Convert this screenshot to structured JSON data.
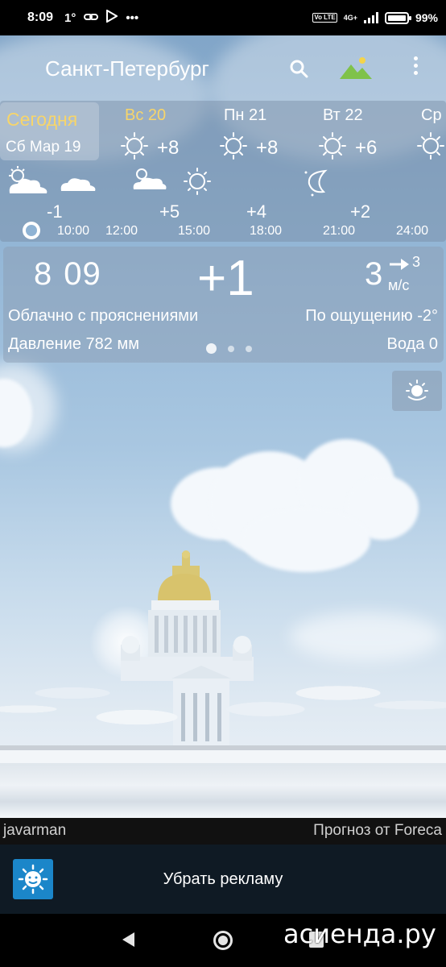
{
  "status": {
    "time": "8:09",
    "temp": "1°",
    "more": "•••",
    "volte": "Vo LTE",
    "net": "4G+",
    "battery": "99%"
  },
  "app": {
    "city": "Санкт-Петербург"
  },
  "days": {
    "today_label": "Сегодня",
    "today_date": "Сб Мар 19",
    "items": [
      {
        "name": "Вс 20",
        "temp": "+8"
      },
      {
        "name": "Пн 21",
        "temp": "+8"
      },
      {
        "name": "Вт 22",
        "temp": "+6"
      },
      {
        "name": "Ср",
        "temp": ""
      }
    ]
  },
  "hours": {
    "temps": [
      "-1",
      "+5",
      "+4",
      "+2"
    ],
    "times": [
      "10:00",
      "12:00",
      "15:00",
      "18:00",
      "21:00",
      "24:00"
    ]
  },
  "current": {
    "clock_h": "8",
    "clock_m": "09",
    "temp": "+1",
    "wind_speed": "3",
    "wind_gust": "3",
    "wind_unit": "м/с",
    "condition": "Облачно с прояснениями",
    "feels_like": "По ощущению -2°",
    "pressure": "Давление 782 мм",
    "water": "Вода 0"
  },
  "credits": {
    "author": "javarman",
    "provider": "Прогноз от Foreca"
  },
  "ad": {
    "remove_ads": "Убрать рекламу"
  },
  "watermark": "асиенда.ру",
  "colors": {
    "today_label": "#f7d56a",
    "panel": "rgba(120,140,165,0.45)",
    "ad_icon": "#1b86c9"
  }
}
